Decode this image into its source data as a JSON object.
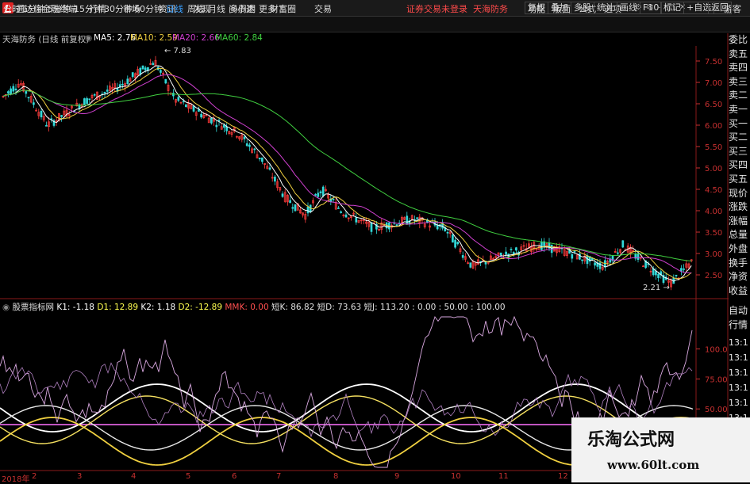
{
  "app": {
    "title": "通达信金融终端",
    "menu": [
      "行情",
      "市场",
      "资讯",
      "发现",
      "问小达",
      "财富圈",
      "交易"
    ],
    "login_status": "证券交易未登录",
    "stock_name_title": "天海防务",
    "right_menu": [
      "功能",
      "版面",
      "公式",
      "选项"
    ],
    "guest": "游客"
  },
  "toolbar": {
    "periods": [
      "分时",
      "1分钟",
      "5分钟",
      "15分钟",
      "30分钟",
      "60分钟",
      "日线",
      "周线",
      "月线",
      "多周期",
      "更多"
    ],
    "active": "日线",
    "right": [
      "复权",
      "叠加",
      "多股",
      "统计",
      "画线",
      "F10",
      "标记",
      "+自选",
      "返回"
    ]
  },
  "chart": {
    "stock_label": "天海防务 (日线 前复权)",
    "ma": [
      {
        "label": "MA5: 2.76",
        "color": "#ffffff"
      },
      {
        "label": "MA10: 2.59",
        "color": "#f0d040"
      },
      {
        "label": "MA20: 2.66",
        "color": "#d040d0"
      },
      {
        "label": "MA60: 2.84",
        "color": "#40d040"
      }
    ],
    "price_ticks": [
      "7.50",
      "7.00",
      "6.50",
      "6.00",
      "5.50",
      "5.00",
      "4.50",
      "4.00",
      "3.50",
      "3.00",
      "2.50"
    ],
    "high_label": "7.83",
    "low_label": "2.21",
    "colors": {
      "up": "#ff3c3c",
      "down": "#32d8d8",
      "ma5": "#ffffff",
      "ma10": "#f0d040",
      "ma20": "#d040d0",
      "ma60": "#40d040"
    }
  },
  "indicator": {
    "name": "股票指标网",
    "values": [
      {
        "label": "K1: -1.18",
        "color": "#ffffff"
      },
      {
        "label": "D1: 12.89",
        "color": "#ffff50"
      },
      {
        "label": "K2: 1.18",
        "color": "#ffffff"
      },
      {
        "label": "D2: -12.89",
        "color": "#ffff50"
      },
      {
        "label": "MMK: 0.00",
        "color": "#ff5050"
      },
      {
        "label": "短K: 86.82",
        "color": "#e0e0e0"
      },
      {
        "label": "短D: 73.63",
        "color": "#e0e0e0"
      },
      {
        "label": "短J: 113.20 : 0.00 : 50.00 : 100.00",
        "color": "#e0e0e0"
      }
    ],
    "ticks": [
      "100.0",
      "75.00",
      "50.00"
    ]
  },
  "right_panel": {
    "quote_labels": [
      "委比",
      "卖五",
      "卖四",
      "卖三",
      "卖二",
      "卖一",
      "买一",
      "买二",
      "买三",
      "买四",
      "买五",
      "现价",
      "涨跌",
      "涨幅",
      "总量",
      "外盘",
      "换手",
      "净资",
      "收益"
    ],
    "lower_labels": [
      "自动",
      "行情"
    ],
    "times": [
      "13:1",
      "13:1",
      "13:1",
      "13:1",
      "13:1",
      "13:1",
      "13:1",
      "13:1"
    ]
  },
  "date_axis": [
    "2018年",
    "2",
    "3",
    "4",
    "5",
    "6",
    "7",
    "8",
    "9",
    "10",
    "11",
    "12"
  ],
  "watermark": {
    "title": "乐淘公式网",
    "url": "www.60lt.com"
  }
}
